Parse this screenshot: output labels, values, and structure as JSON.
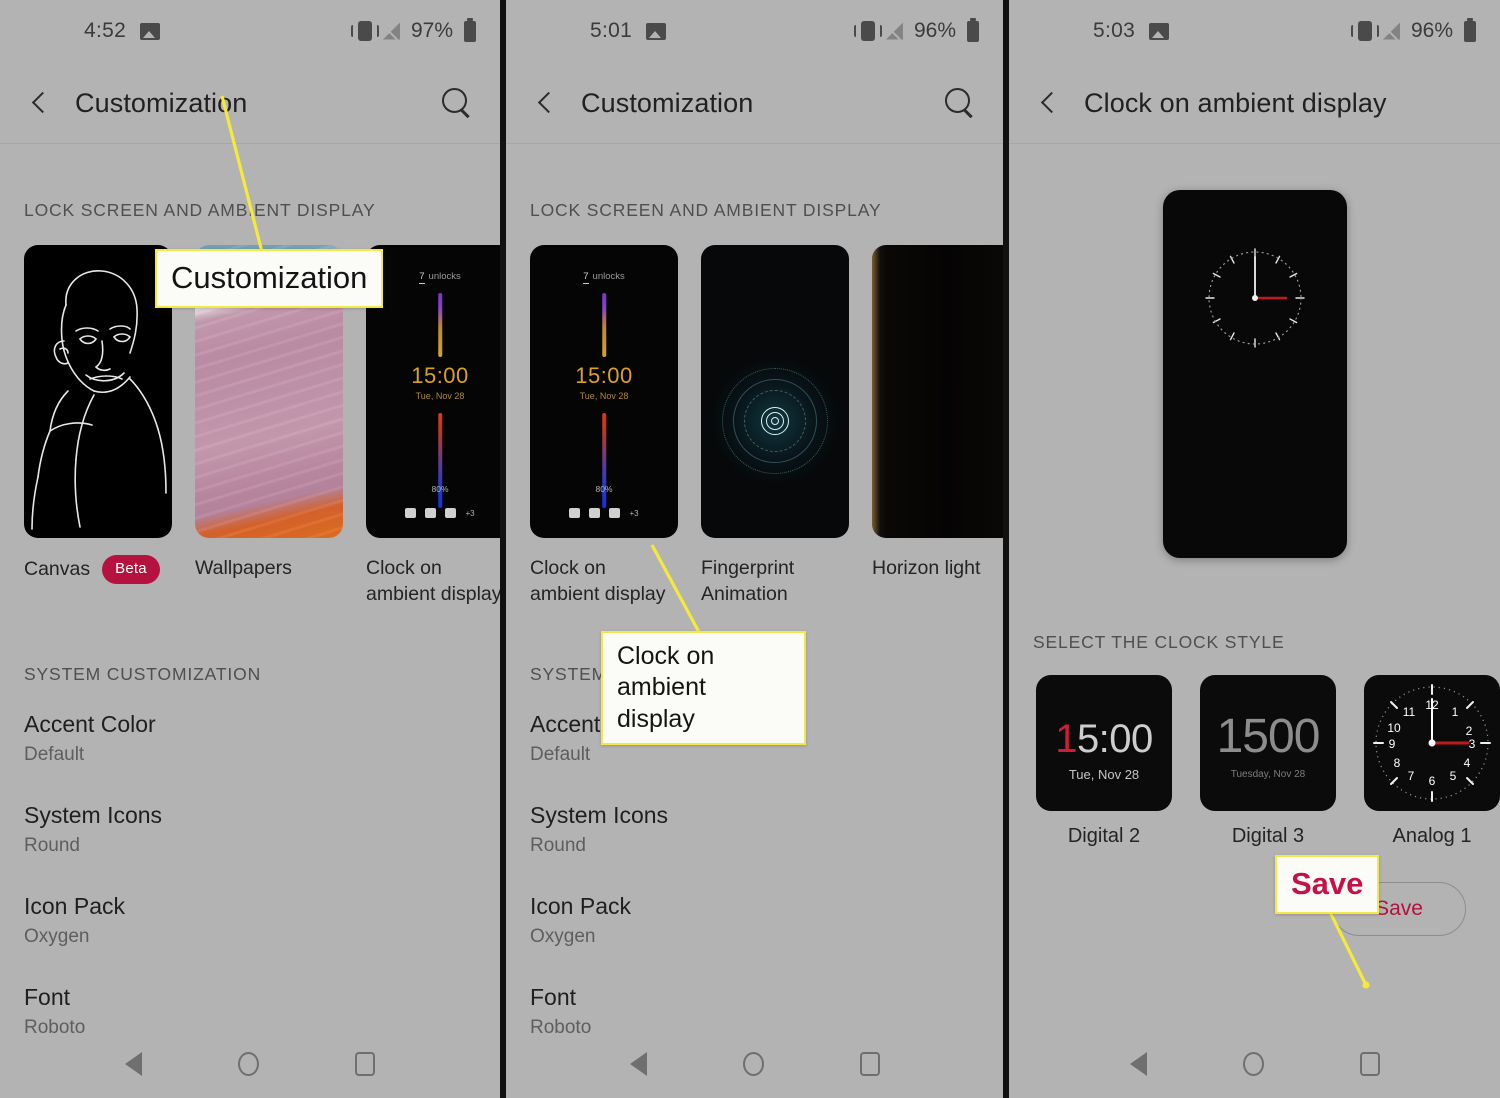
{
  "panels": [
    {
      "status": {
        "time": "4:52",
        "battery_pct": "97%",
        "icons": [
          "photo-icon",
          "vibrate-icon",
          "no-signal-icon",
          "battery-icon"
        ]
      },
      "appbar": {
        "title": "Customization",
        "back": "back-chevron-icon",
        "search": "search-icon"
      },
      "section_lock": "LOCK SCREEN AND AMBIENT DISPLAY",
      "tiles": [
        {
          "label": "Canvas",
          "badge": "Beta",
          "art": "canvas-portrait"
        },
        {
          "label": "Wallpapers",
          "badge": "",
          "art": "wallpaper-waves"
        },
        {
          "label": "Clock on ambient display",
          "badge": "",
          "art": "ambient-clock"
        }
      ],
      "section_system": "SYSTEM CUSTOMIZATION",
      "settings": [
        {
          "title": "Accent Color",
          "value": "Default"
        },
        {
          "title": "System Icons",
          "value": "Round"
        },
        {
          "title": "Icon Pack",
          "value": "Oxygen"
        },
        {
          "title": "Font",
          "value": "Roboto"
        }
      ]
    },
    {
      "status": {
        "time": "5:01",
        "battery_pct": "96%"
      },
      "appbar": {
        "title": "Customization"
      },
      "section_lock": "LOCK SCREEN AND AMBIENT DISPLAY",
      "tiles": [
        {
          "label": "Clock on ambient display",
          "badge": "",
          "art": "ambient-clock"
        },
        {
          "label": "Fingerprint Animation",
          "badge": "",
          "art": "fingerprint"
        },
        {
          "label": "Horizon light",
          "badge": "",
          "art": "horizon-light"
        }
      ],
      "section_system": "SYSTEM CUSTOMIZATION",
      "settings": [
        {
          "title": "Accent Color",
          "value": "Default"
        },
        {
          "title": "System Icons",
          "value": "Round"
        },
        {
          "title": "Icon Pack",
          "value": "Oxygen"
        },
        {
          "title": "Font",
          "value": "Roboto"
        }
      ]
    },
    {
      "status": {
        "time": "5:03",
        "battery_pct": "96%"
      },
      "appbar": {
        "title": "Clock on ambient display"
      },
      "section_clock": "SELECT THE CLOCK STYLE",
      "clock_styles": [
        {
          "label": "Digital 2",
          "time": "15:00",
          "date": "Tue, Nov 28"
        },
        {
          "label": "Digital 3",
          "time": "1500",
          "date": "Tuesday, Nov 28"
        },
        {
          "label": "Analog 1",
          "time": "",
          "date": ""
        }
      ],
      "save_label": "Save"
    }
  ],
  "ambient_tile": {
    "unlocks_count": "7",
    "unlocks_word": "unlocks",
    "time": "15:00",
    "date": "Tue, Nov 28",
    "battery": "80%",
    "more_apps": "+3"
  },
  "callouts": [
    {
      "text": "Customization"
    },
    {
      "text": "Clock on ambient display"
    },
    {
      "text": "Save"
    }
  ],
  "navbar": {
    "back": "nav-back-icon",
    "home": "nav-home-icon",
    "recents": "nav-recents-icon"
  },
  "colors": {
    "screen_bg": "#b3b3b3",
    "accent_crimson": "#b5123f",
    "callout_border": "#f2e84a",
    "callout_bg": "#fbfbf7",
    "leader_line": "#f5e93b"
  }
}
